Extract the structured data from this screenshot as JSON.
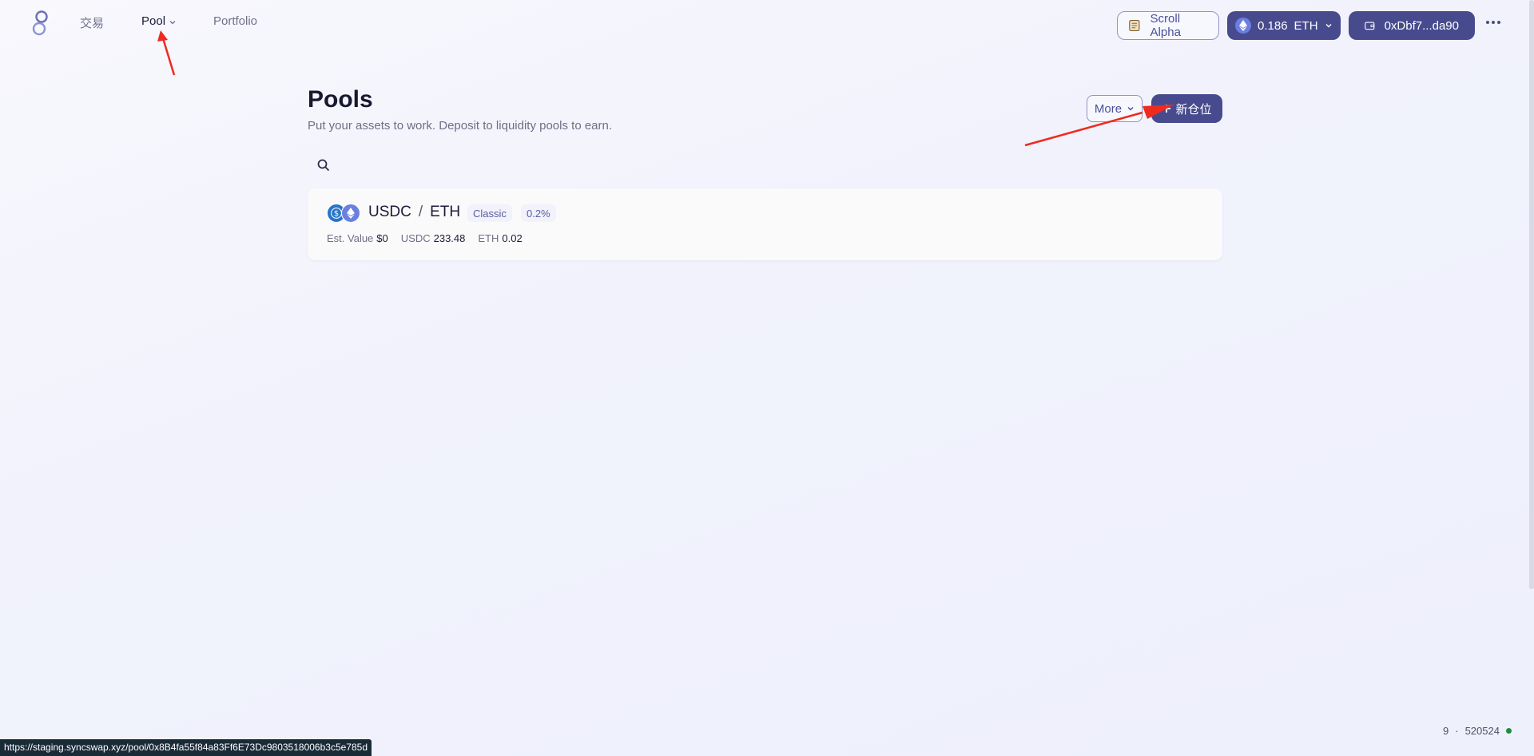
{
  "header": {
    "nav": {
      "trade_label": "交易",
      "pool_label": "Pool",
      "portfolio_label": "Portfolio"
    },
    "network_label": "Scroll Alpha",
    "balance": {
      "amount": "0.186",
      "symbol": "ETH"
    },
    "wallet_address": "0xDbf7...da90"
  },
  "main": {
    "title": "Pools",
    "subtitle": "Put your assets to work. Deposit to liquidity pools to earn.",
    "more_label": "More",
    "new_position_label": "新仓位",
    "search": {
      "value": "",
      "placeholder": ""
    }
  },
  "pools": [
    {
      "token_a": "USDC",
      "separator": "/",
      "token_b": "ETH",
      "pool_type": "Classic",
      "fee": "0.2%",
      "est_value_label": "Est. Value",
      "est_value": "$0",
      "token_a_amount": "233.48",
      "token_b_amount": "0.02"
    }
  ],
  "status": {
    "link_url": "https://staging.syncswap.xyz/pool/0x8B4fa55f84a83Ff6E73Dc9803518006b3c5e785d",
    "block_left": "9",
    "block_sep": "·",
    "block_number": "520524"
  },
  "colors": {
    "accent": "#474b8e",
    "accent_border": "#8f93c7",
    "status_green": "#1f8c3e",
    "annotation_red": "#ee2b1e"
  }
}
